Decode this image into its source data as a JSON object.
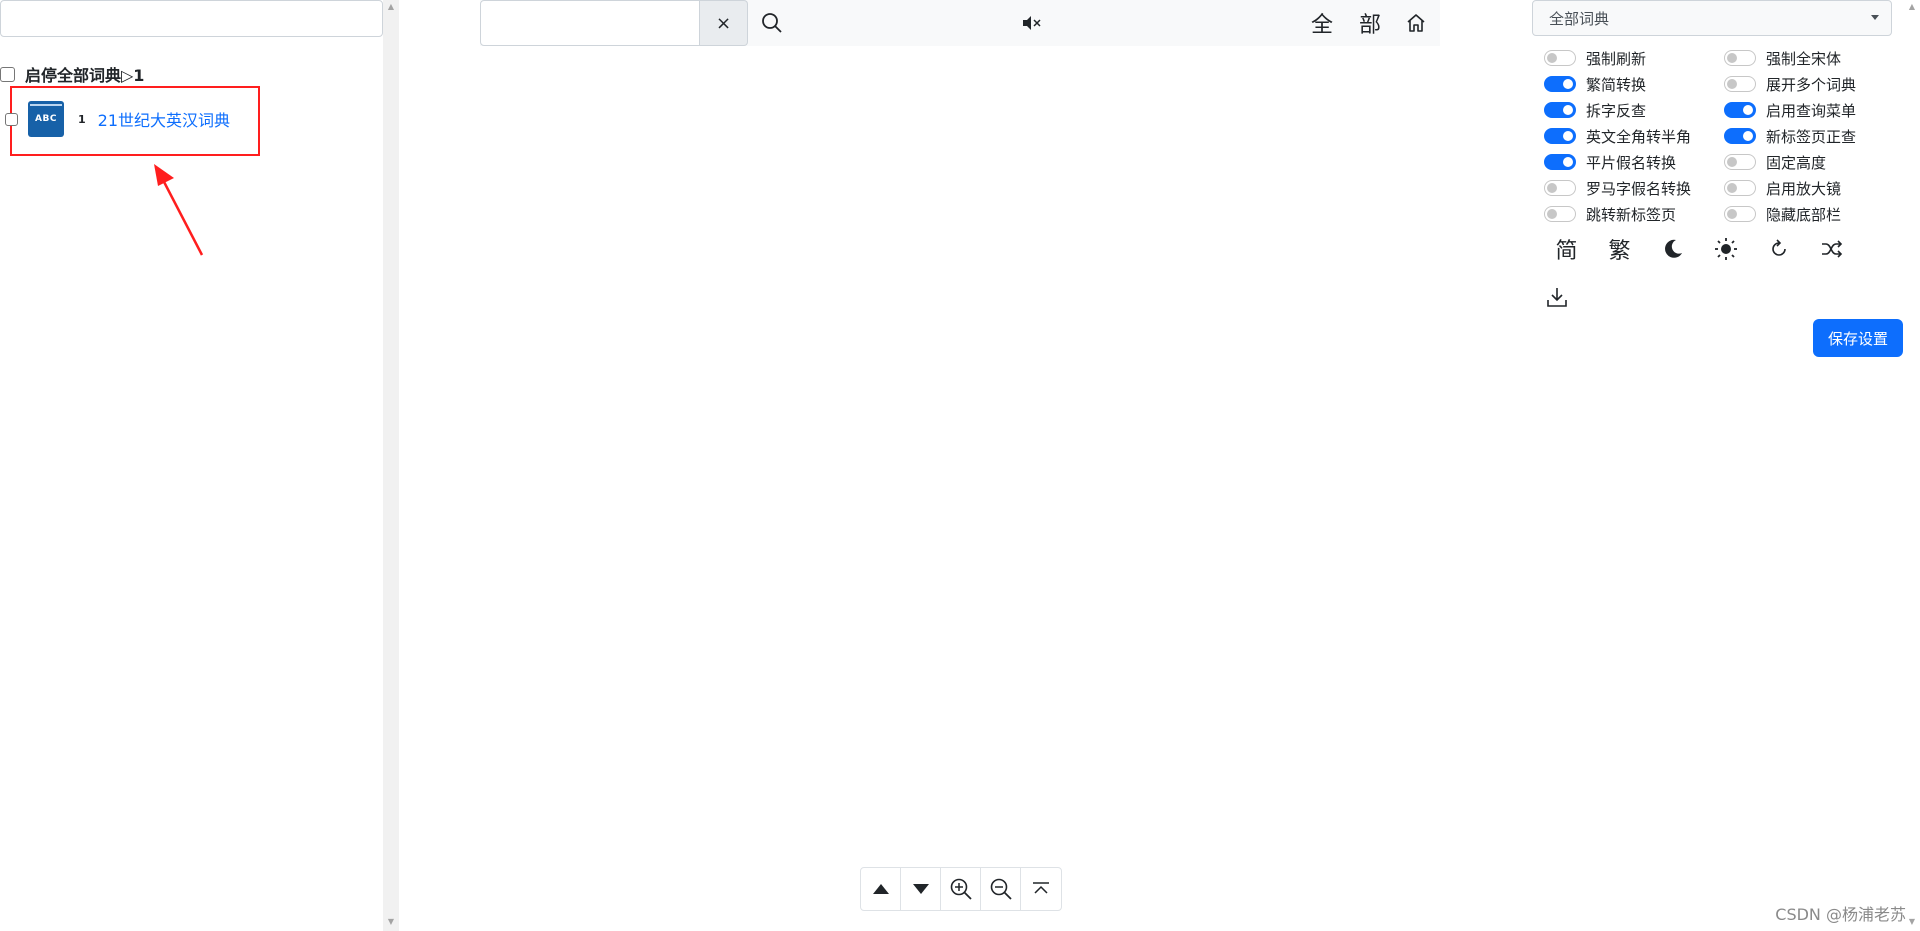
{
  "left_panel": {
    "search_value": "",
    "toggle_all_label": "启停全部词典▷1",
    "dictionaries": [
      {
        "index": "1",
        "icon_text": "ABC",
        "name": "21世纪大英汉词典",
        "checked": false
      }
    ]
  },
  "top_bar": {
    "search_value": "",
    "clear_label": "×",
    "search_icon": "search-icon",
    "mute_icon": "volume-mute-icon",
    "all_label": "全",
    "section_label": "部",
    "home_icon": "home-icon"
  },
  "bottom_tools": {
    "icons": [
      "triangle-up-icon",
      "triangle-down-icon",
      "zoom-in-icon",
      "zoom-out-icon",
      "scroll-top-icon"
    ]
  },
  "settings": {
    "dict_select_value": "全部词典",
    "left_options": [
      {
        "label": "强制刷新",
        "on": false
      },
      {
        "label": "繁简转换",
        "on": true
      },
      {
        "label": "拆字反查",
        "on": true
      },
      {
        "label": "英文全角转半角",
        "on": true
      },
      {
        "label": "平片假名转换",
        "on": true
      },
      {
        "label": "罗马字假名转换",
        "on": false
      },
      {
        "label": "跳转新标签页",
        "on": false
      }
    ],
    "right_options": [
      {
        "label": "强制全宋体",
        "on": false
      },
      {
        "label": "展开多个词典",
        "on": false
      },
      {
        "label": "启用查询菜单",
        "on": true
      },
      {
        "label": "新标签页正查",
        "on": true
      },
      {
        "label": "固定高度",
        "on": false
      },
      {
        "label": "启用放大镜",
        "on": false
      },
      {
        "label": "隐藏底部栏",
        "on": false
      }
    ],
    "simplified_label": "简",
    "traditional_label": "繁",
    "icons": [
      "moon-icon",
      "sun-icon",
      "refresh-icon",
      "shuffle-icon",
      "download-icon"
    ],
    "save_label": "保存设置"
  },
  "colors": {
    "accent": "#0d6efd",
    "annotation": "#ff1e1e"
  },
  "watermark": "CSDN @杨浦老苏"
}
